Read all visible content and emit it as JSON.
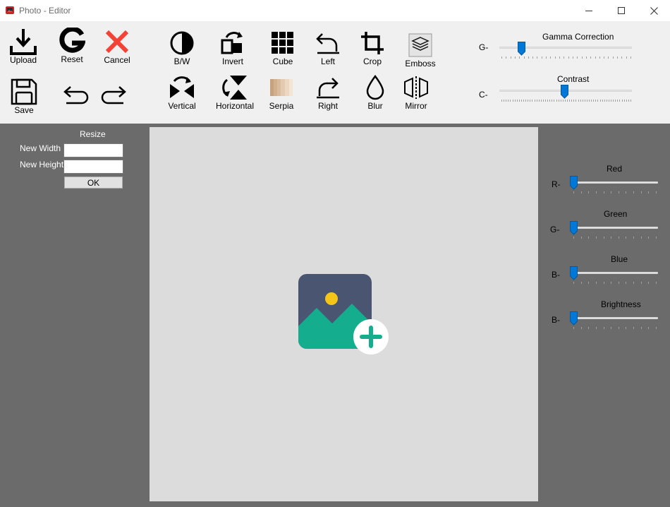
{
  "window": {
    "title": "Photo - Editor",
    "icon": "app-photo-icon",
    "accent_color": "#0078d7"
  },
  "toolbar": {
    "upload": "Upload",
    "reset": "Reset",
    "cancel": "Cancel",
    "save": "Save",
    "bw": "B/W",
    "invert": "Invert",
    "cube": "Cube",
    "left": "Left",
    "crop": "Crop",
    "emboss": "Emboss",
    "vertical": "Vertical",
    "horizontal": "Horizontal",
    "serpia": "Serpia",
    "right": "Right",
    "blur": "Blur",
    "mirror": "Mirror"
  },
  "top_sliders": {
    "gamma": {
      "title": "Gamma Correction",
      "prefix": "G-",
      "value": 0.16
    },
    "contrast": {
      "title": "Contrast",
      "prefix": "C-",
      "value": 0.5
    }
  },
  "resize": {
    "title": "Resize",
    "width_label": "New Width",
    "height_label": "New Height",
    "width_value": "",
    "height_value": "",
    "ok": "OK"
  },
  "canvas": {
    "placeholder_icon": "add-image-icon"
  },
  "color_sliders": {
    "red": {
      "title": "Red",
      "prefix": "R-",
      "value": 0
    },
    "green": {
      "title": "Green",
      "prefix": "G-",
      "value": 0
    },
    "blue": {
      "title": "Blue",
      "prefix": "B-",
      "value": 0
    },
    "brightness": {
      "title": "Brightness",
      "prefix": "B-",
      "value": 0
    }
  }
}
